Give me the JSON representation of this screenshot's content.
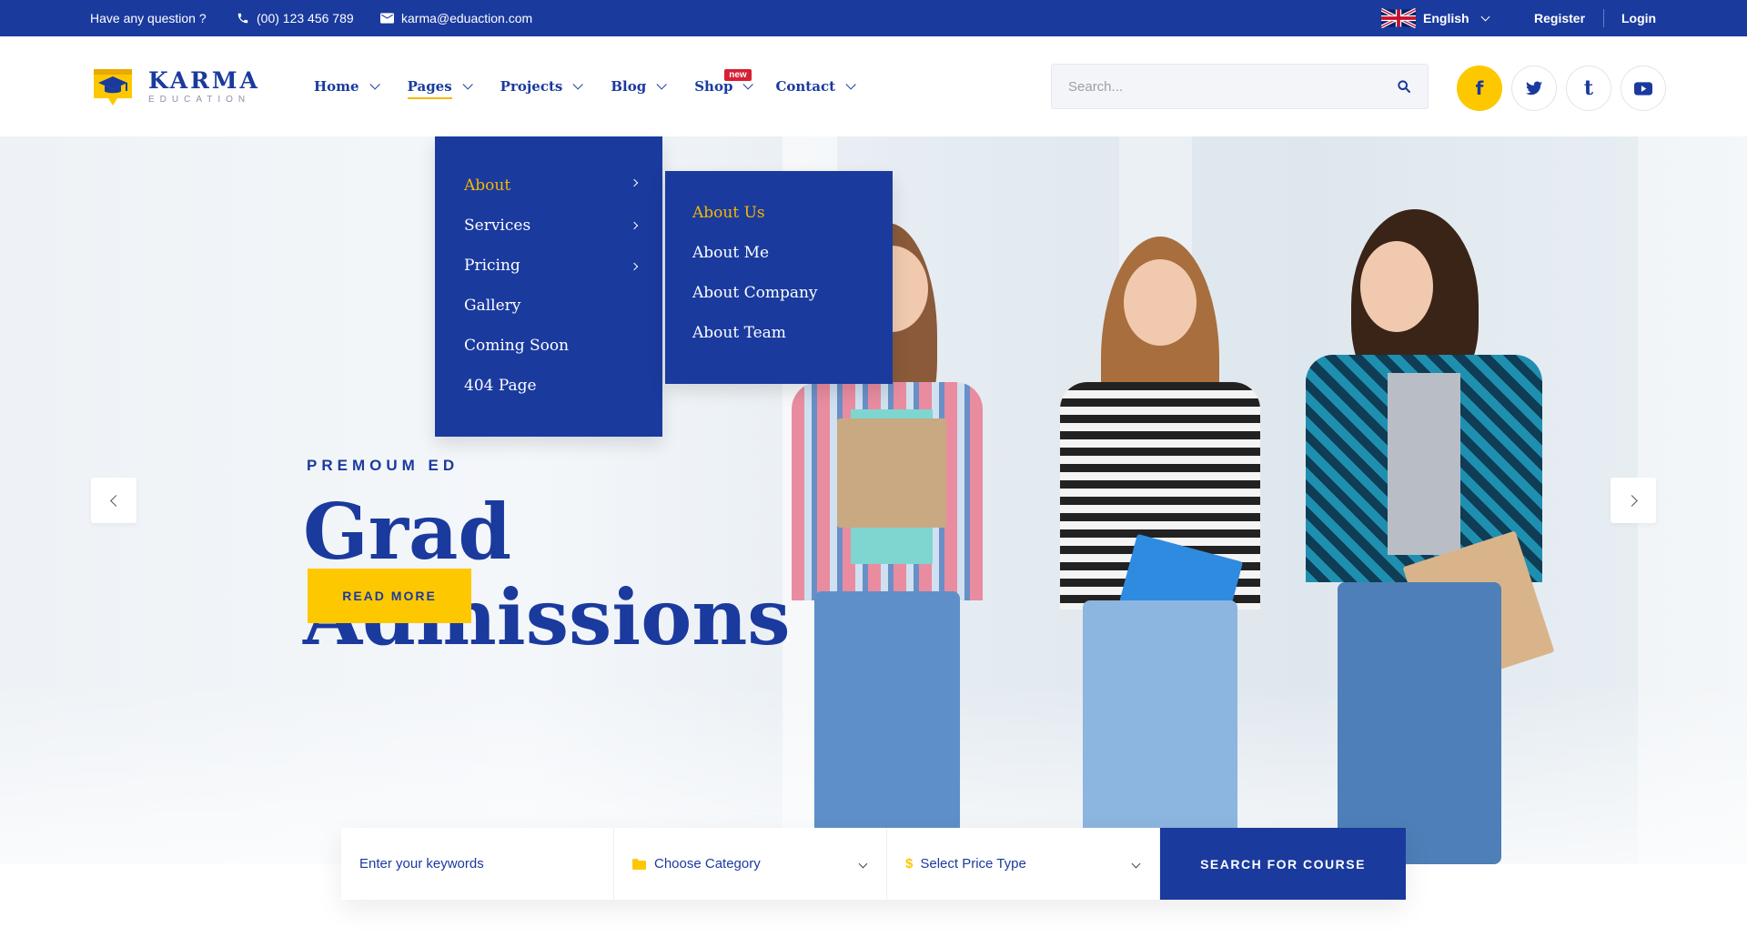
{
  "topbar": {
    "question": "Have any question ?",
    "phone": "(00) 123 456 789",
    "email": "karma@eduaction.com",
    "language": "English",
    "register": "Register",
    "login": "Login"
  },
  "logo": {
    "name": "KARMA",
    "sub": "EDUCATION"
  },
  "nav": {
    "items": [
      {
        "label": "Home"
      },
      {
        "label": "Pages"
      },
      {
        "label": "Projects"
      },
      {
        "label": "Blog"
      },
      {
        "label": "Shop",
        "badge": "new"
      },
      {
        "label": "Contact"
      }
    ]
  },
  "search": {
    "placeholder": "Search..."
  },
  "social": {
    "facebook": "f",
    "tumblr": "t"
  },
  "pages_menu": {
    "items": [
      "About",
      "Services",
      "Pricing",
      "Gallery",
      "Coming Soon",
      "404 Page"
    ]
  },
  "about_menu": {
    "items": [
      "About Us",
      "About Me",
      "About Company",
      "About Team"
    ]
  },
  "hero": {
    "eyebrow": "PREMOUM ED",
    "title_line1": "Grad",
    "title_line2": "Admissions",
    "button": "READ MORE"
  },
  "course_search": {
    "keywords_placeholder": "Enter your keywords",
    "category": "Choose Category",
    "price": "Select Price Type",
    "button": "SEARCH FOR COURSE"
  },
  "colors": {
    "primary": "#1a3a9e",
    "accent": "#fdc800",
    "badge": "#d71f35"
  }
}
